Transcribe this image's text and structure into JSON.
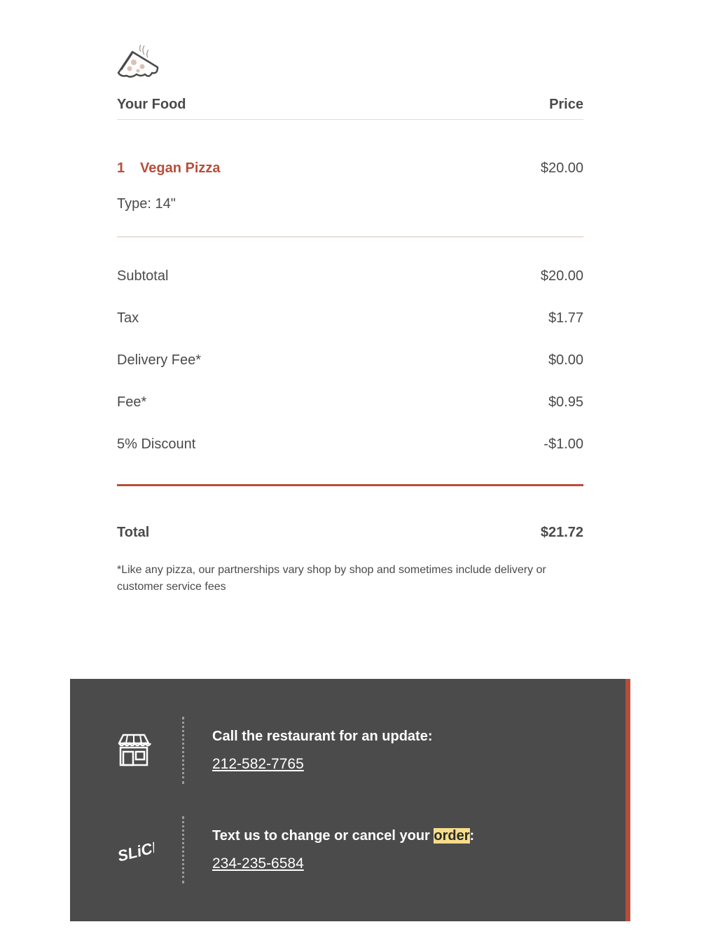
{
  "header": {
    "logo_icon": "pizza-slice-icon",
    "col_food": "Your Food",
    "col_price": "Price"
  },
  "items": [
    {
      "qty": "1",
      "name": "Vegan Pizza",
      "price": "$20.00",
      "option": "Type: 14\""
    }
  ],
  "summary": [
    {
      "label": "Subtotal",
      "value": "$20.00"
    },
    {
      "label": "Tax",
      "value": "$1.77"
    },
    {
      "label": "Delivery Fee*",
      "value": "$0.00"
    },
    {
      "label": "Fee*",
      "value": "$0.95"
    },
    {
      "label": "5% Discount",
      "value": "-$1.00"
    }
  ],
  "total": {
    "label": "Total",
    "value": "$21.72"
  },
  "footnote": "*Like any pizza, our partnerships vary shop by shop and sometimes include delivery or customer service fees",
  "footer": {
    "restaurant": {
      "icon": "storefront-icon",
      "title": "Call the restaurant for an update:",
      "phone": "212-582-7765"
    },
    "slice": {
      "icon": "slice-logo",
      "logo_text": "SLiCE",
      "title_before": "Text us to change or cancel your ",
      "title_highlight": "order",
      "title_after": ":",
      "phone": "234-235-6584"
    }
  },
  "colors": {
    "accent": "#b84d3a",
    "text": "#4a4a4a",
    "footer_bg": "#4b4b4b",
    "highlight": "#f7dd8a"
  }
}
